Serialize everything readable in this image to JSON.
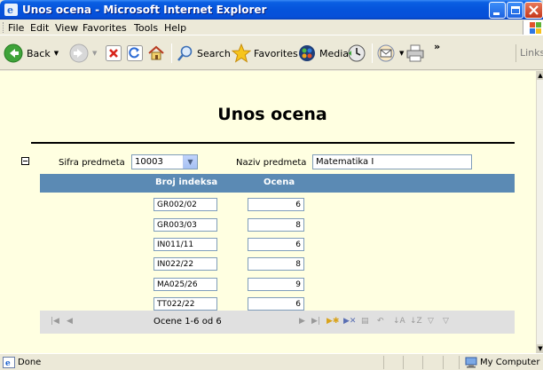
{
  "window": {
    "title": "Unos ocena - Microsoft Internet Explorer",
    "menu": [
      "File",
      "Edit",
      "View",
      "Favorites",
      "Tools",
      "Help"
    ]
  },
  "toolbar": {
    "back_label": "Back",
    "search_label": "Search",
    "favorites_label": "Favorites",
    "media_label": "Media",
    "links_label": "Links",
    "overflow_glyph": "»"
  },
  "page": {
    "title": "Unos ocena",
    "sifra_label": "Sifra predmeta",
    "sifra_value": "10003",
    "naziv_label": "Naziv predmeta",
    "naziv_value": "Matematika I"
  },
  "grid": {
    "columns": [
      "Broj indeksa",
      "Ocena"
    ],
    "rows": [
      {
        "index": "GR002/02",
        "grade": "6"
      },
      {
        "index": "GR003/03",
        "grade": "8"
      },
      {
        "index": "IN011/11",
        "grade": "6"
      },
      {
        "index": "IN022/22",
        "grade": "8"
      },
      {
        "index": "MA025/26",
        "grade": "9"
      },
      {
        "index": "TT022/22",
        "grade": "6"
      }
    ],
    "pager_text": "Ocene 1-6 od 6"
  },
  "status": {
    "left": "Done",
    "zone": "My Computer"
  },
  "colors": {
    "titlebar": "#0553DB",
    "page_bg": "#FFFFE1",
    "grid_header": "#5B8AB4",
    "navbar": "#E0E0E0"
  }
}
